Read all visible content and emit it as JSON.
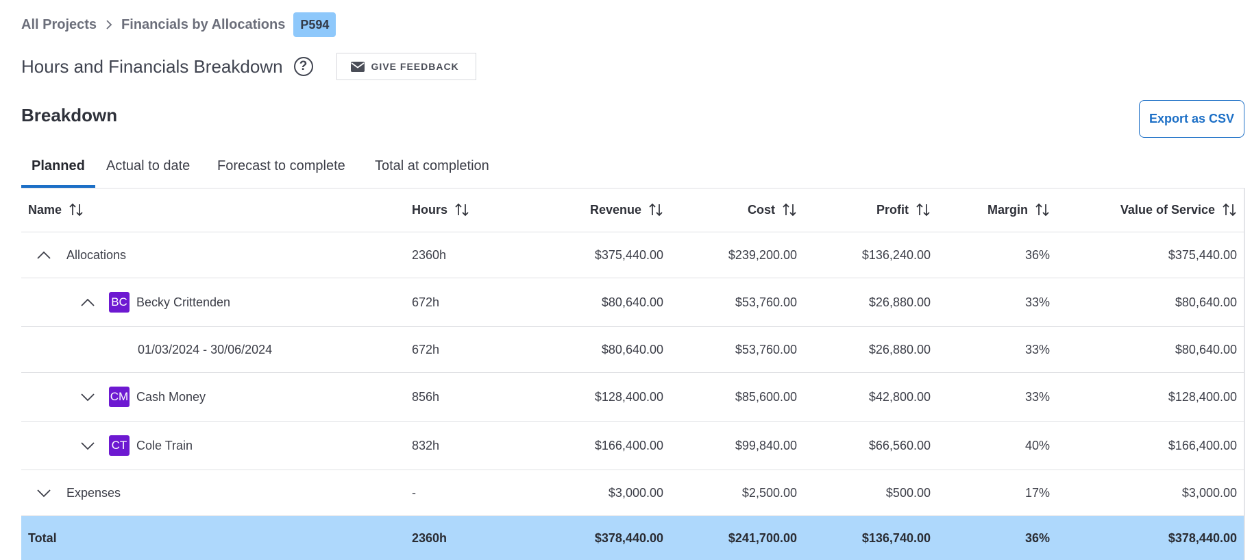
{
  "breadcrumb": {
    "items": [
      "All Projects",
      "Financials by Allocations"
    ],
    "badge": "P594"
  },
  "header": {
    "title": "Hours and Financials Breakdown",
    "help_glyph": "?",
    "feedback_label": "GIVE FEEDBACK"
  },
  "section": {
    "title": "Breakdown",
    "export_label": "Export as CSV"
  },
  "tabs": [
    {
      "label": "Planned",
      "active": true
    },
    {
      "label": "Actual to date",
      "active": false
    },
    {
      "label": "Forecast to complete",
      "active": false
    },
    {
      "label": "Total at completion",
      "active": false
    }
  ],
  "table": {
    "columns": [
      "Name",
      "Hours",
      "Revenue",
      "Cost",
      "Profit",
      "Margin",
      "Value of Service"
    ],
    "rows": [
      {
        "name": "Allocations",
        "hours": "2360h",
        "revenue": "$375,440.00",
        "cost": "$239,200.00",
        "profit": "$136,240.00",
        "margin": "36%",
        "value": "$375,440.00",
        "expanded": true
      },
      {
        "name": "Becky Crittenden",
        "initials": "BC",
        "hours": "672h",
        "revenue": "$80,640.00",
        "cost": "$53,760.00",
        "profit": "$26,880.00",
        "margin": "33%",
        "value": "$80,640.00",
        "expanded": true
      },
      {
        "name": "01/03/2024 - 30/06/2024",
        "hours": "672h",
        "revenue": "$80,640.00",
        "cost": "$53,760.00",
        "profit": "$26,880.00",
        "margin": "33%",
        "value": "$80,640.00"
      },
      {
        "name": "Cash Money",
        "initials": "CM",
        "hours": "856h",
        "revenue": "$128,400.00",
        "cost": "$85,600.00",
        "profit": "$42,800.00",
        "margin": "33%",
        "value": "$128,400.00",
        "expanded": false
      },
      {
        "name": "Cole Train",
        "initials": "CT",
        "hours": "832h",
        "revenue": "$166,400.00",
        "cost": "$99,840.00",
        "profit": "$66,560.00",
        "margin": "40%",
        "value": "$166,400.00",
        "expanded": false
      },
      {
        "name": "Expenses",
        "hours": "-",
        "revenue": "$3,000.00",
        "cost": "$2,500.00",
        "profit": "$500.00",
        "margin": "17%",
        "value": "$3,000.00",
        "expanded": false
      }
    ],
    "total": {
      "name": "Total",
      "hours": "2360h",
      "revenue": "$378,440.00",
      "cost": "$241,700.00",
      "profit": "$136,740.00",
      "margin": "36%",
      "value": "$378,440.00"
    }
  },
  "colors": {
    "accent": "#1c6fc6",
    "badge_bg": "#8ec8fb",
    "avatar_bg": "#6d19d1",
    "total_row_bg": "#aed8fc"
  },
  "icons": {
    "breadcrumb_separator": "chevron-right-icon",
    "help": "question-circle-icon",
    "feedback": "envelope-icon",
    "sort": "sort-arrows-icon",
    "expanded": "chevron-up-icon",
    "collapsed": "chevron-down-icon"
  }
}
